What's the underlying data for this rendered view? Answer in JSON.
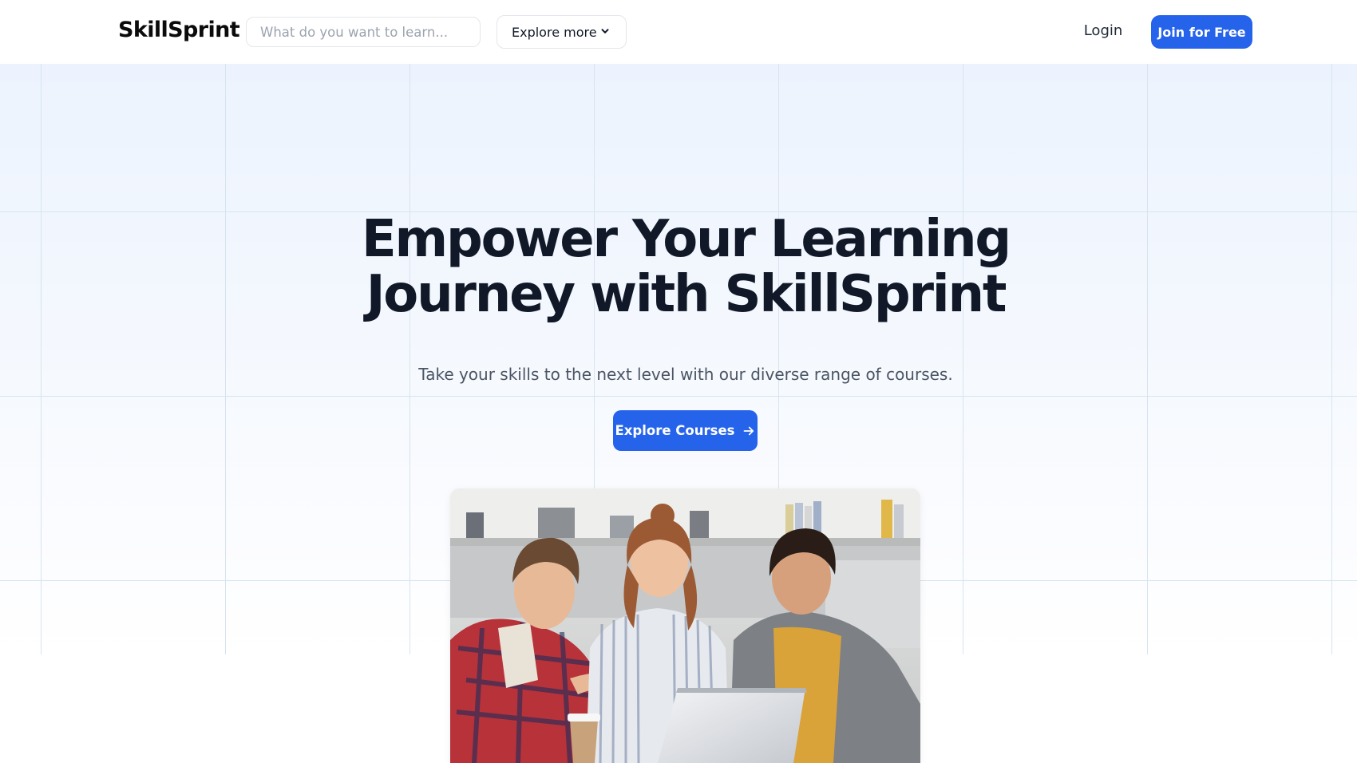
{
  "header": {
    "brand": "SkillSprint",
    "search_placeholder": "What do you want to learn...",
    "explore_more_label": "Explore more",
    "login_label": "Login",
    "join_label": "Join for Free"
  },
  "hero": {
    "headline_line1": "Empower Your Learning",
    "headline_line2": "Journey with SkillSprint",
    "subheadline": "Take your skills to the next level with our diverse range of courses.",
    "cta_label": "Explore Courses"
  },
  "colors": {
    "accent": "#2563eb",
    "heading": "#111827",
    "body_text": "#4b5563",
    "hero_background_top": "#ecf3fe",
    "grid_line": "#d7e4ef"
  },
  "icons": {
    "explore_more": "chevron-down-icon",
    "cta": "arrow-right-icon"
  }
}
